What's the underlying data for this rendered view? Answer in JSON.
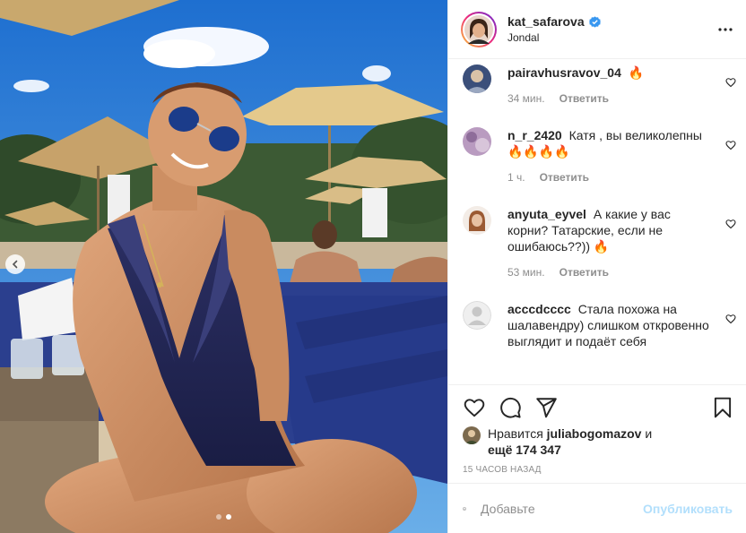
{
  "post": {
    "author": {
      "username": "kat_safarova",
      "verified": true,
      "location": "Jondal"
    },
    "carousel": {
      "slide_count": 2,
      "active_slide": 2
    }
  },
  "comments": [
    {
      "username": "pairavhusravov_04",
      "text": "🔥",
      "time": "34 мин.",
      "reply_label": "Ответить"
    },
    {
      "username": "n_r_2420",
      "text": "Катя , вы великолепны 🔥🔥🔥🔥",
      "time": "1 ч.",
      "reply_label": "Ответить"
    },
    {
      "username": "anyuta_eyvel",
      "text": "А какие у вас корни? Татарские, если не ошибаюсь??)) 🔥",
      "time": "53 мин.",
      "reply_label": "Ответить"
    },
    {
      "username": "acccdcccc",
      "text": "Стала похожа на шалавендру) слишком откровенно выглядит и подаёт себя",
      "time": "",
      "reply_label": ""
    }
  ],
  "likes": {
    "prefix": "Нравится ",
    "first_user": "juliabogomazov",
    "middle": " и",
    "others": "ещё 174 347"
  },
  "timestamp": "15 часов назад",
  "comment_box": {
    "placeholder": "Добавьте",
    "post_label": "Опубликовать"
  },
  "colors": {
    "verified": "#3897f0",
    "post_button_disabled": "#b2dffc",
    "meta_text": "#8e8e8e"
  },
  "icons": {
    "more": "more-horizontal-icon",
    "like": "heart-icon",
    "comment": "comment-bubble-icon",
    "share": "paper-plane-icon",
    "save": "bookmark-icon",
    "emoji": "emoji-smile-icon",
    "carousel_prev": "chevron-left-icon"
  }
}
